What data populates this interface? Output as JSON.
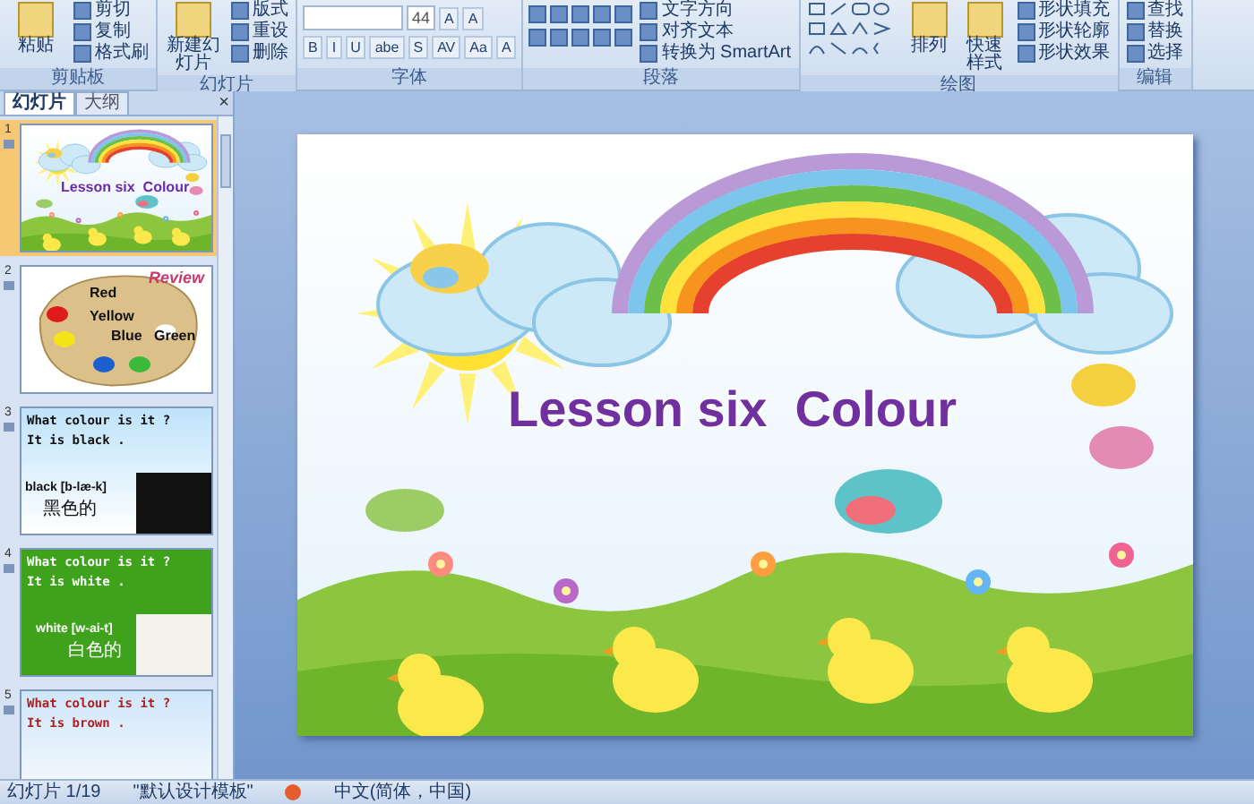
{
  "ribbon": {
    "groups": [
      {
        "kind": "buttons",
        "label": "剪贴板",
        "large": [
          {
            "label": "粘贴"
          }
        ],
        "small": [
          {
            "label": "剪切"
          },
          {
            "label": "复制"
          },
          {
            "label": "格式刷"
          }
        ]
      },
      {
        "kind": "buttons",
        "label": "幻灯片",
        "large": [
          {
            "label": "新建幻灯片"
          }
        ],
        "small": [
          {
            "label": "版式"
          },
          {
            "label": "重设"
          },
          {
            "label": "删除"
          }
        ]
      },
      {
        "kind": "font",
        "label": "字体",
        "size": "44",
        "grow": [
          "A",
          "A"
        ],
        "buttons": [
          "B",
          "I",
          "U",
          "abe",
          "S",
          "AV",
          "Aa",
          "A"
        ]
      },
      {
        "kind": "paragraph",
        "label": "段落",
        "small": [
          {
            "label": "文字方向"
          },
          {
            "label": "对齐文本"
          },
          {
            "label": "转换为 SmartArt"
          }
        ]
      },
      {
        "kind": "drawing",
        "label": "绘图",
        "large": [
          {
            "label": "排列"
          },
          {
            "label": "快速样式"
          }
        ],
        "small": [
          {
            "label": "形状填充"
          },
          {
            "label": "形状轮廓"
          },
          {
            "label": "形状效果"
          }
        ]
      },
      {
        "kind": "buttons",
        "label": "编辑",
        "small": [
          {
            "label": "查找"
          },
          {
            "label": "替换"
          },
          {
            "label": "选择"
          }
        ]
      }
    ]
  },
  "slide_panel": {
    "tabs": [
      {
        "label": "幻灯片",
        "selected": true
      },
      {
        "label": "大纲",
        "selected": false
      }
    ],
    "close": "×",
    "slides": [
      {
        "number": "1",
        "kind": "title",
        "selected": true,
        "title": "Lesson six  Colour"
      },
      {
        "number": "2",
        "kind": "palette",
        "selected": false,
        "heading": "Review",
        "paints": [
          {
            "label": "Red",
            "color": "#e01b1b"
          },
          {
            "label": "Yellow",
            "color": "#f5e31a"
          },
          {
            "label": "Blue",
            "color": "#1e5fd0"
          },
          {
            "label": "Green",
            "color": "#3cb83a"
          }
        ]
      },
      {
        "number": "3",
        "kind": "word",
        "selected": false,
        "lines": [
          "What colour is it ?",
          "It is black ."
        ],
        "word": "black [b-læ-k]",
        "meaning": "黑色的"
      },
      {
        "number": "4",
        "kind": "word",
        "selected": false,
        "lines": [
          "What colour is it ?",
          "It is white ."
        ],
        "word": "white [w-ai-t]",
        "meaning": "白色的"
      },
      {
        "number": "5",
        "kind": "word",
        "selected": false,
        "lines": [
          "What colour is it ?",
          "It is brown ."
        ]
      }
    ]
  },
  "slide": {
    "title": "Lesson six  Colour"
  },
  "status_bar": {
    "slide_info": "幻灯片 1/19",
    "theme": "\"默认设计模板\"",
    "language": "中文(简体，中国)"
  }
}
